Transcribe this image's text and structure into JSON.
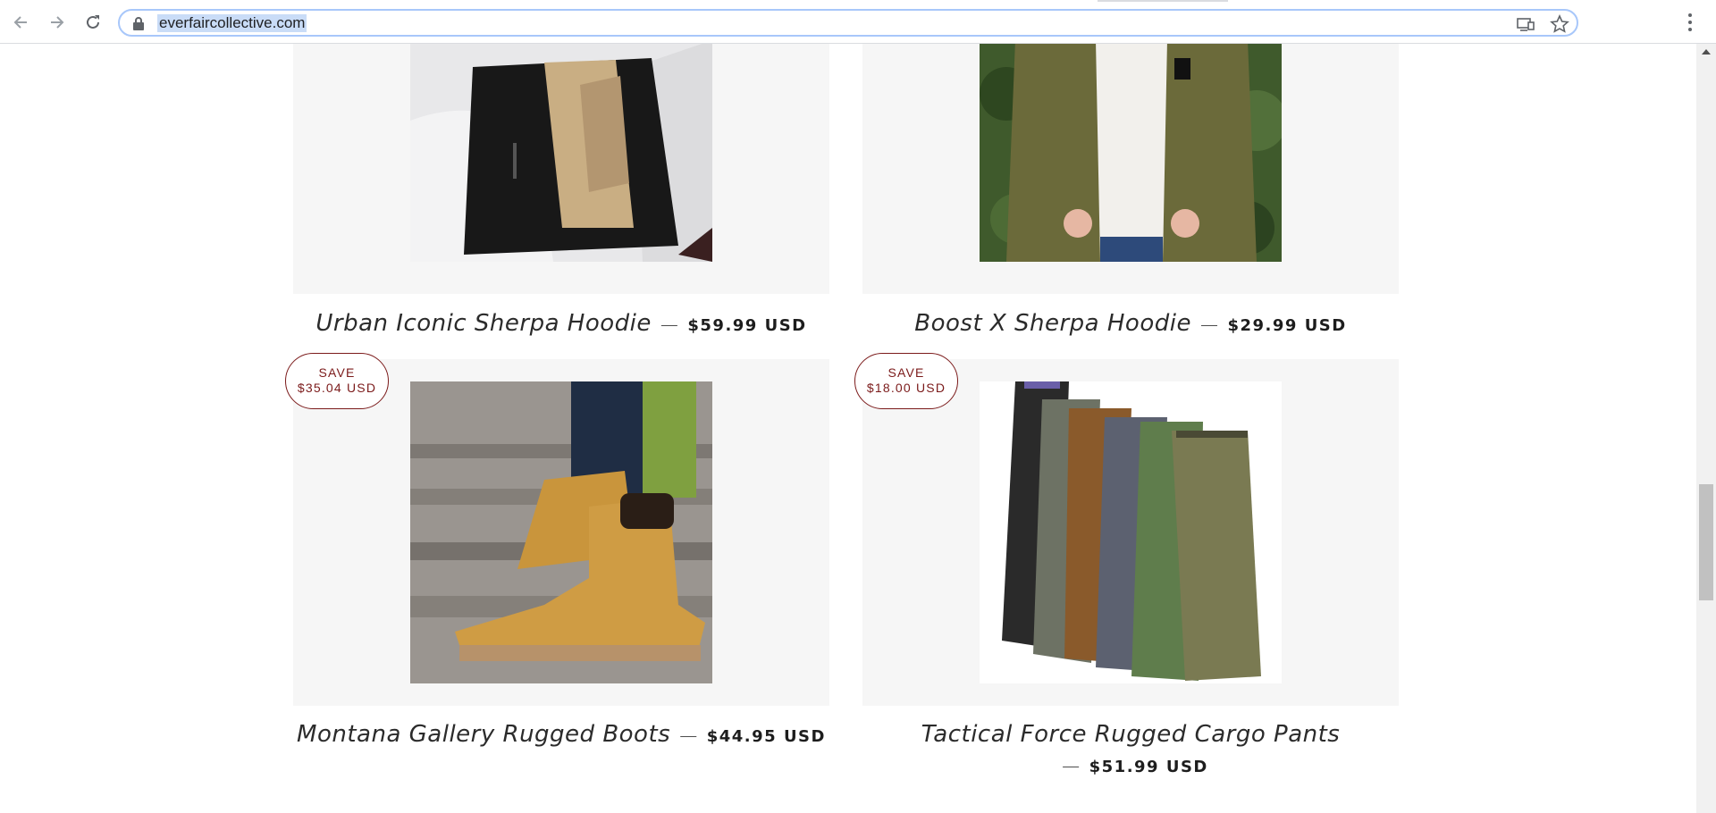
{
  "browser": {
    "url": "everfaircollective.com",
    "icons": {
      "back": "arrow-left-icon",
      "forward": "arrow-right-icon",
      "reload": "reload-icon",
      "lock": "lock-icon",
      "cast": "cast-icon",
      "bookmark": "star-icon",
      "menu": "vertical-dots-icon"
    }
  },
  "products": [
    {
      "name": "Urban Iconic Sherpa Hoodie",
      "separator": "—",
      "price": "$59.99 USD",
      "image": "black sherpa-lined hoodie"
    },
    {
      "name": "Boost X Sherpa Hoodie",
      "separator": "—",
      "price": "$29.99 USD",
      "image": "olive sherpa hoodie worn over white tee"
    },
    {
      "name": "Montana Gallery Rugged Boots",
      "separator": "—",
      "price": "$44.95 USD",
      "badge_line1": "SAVE",
      "badge_line2": "$35.04 USD",
      "image": "tan lace-up work boots"
    },
    {
      "name": "Tactical Force Rugged Cargo Pants",
      "separator": "—",
      "price": "$51.99 USD",
      "badge_line1": "SAVE",
      "badge_line2": "$18.00 USD",
      "image": "stack of cargo pants in several colors"
    }
  ],
  "colors": {
    "card_background": "#f6f6f6",
    "badge": "#7b1a1a",
    "url_highlight": "#c9dcf7"
  }
}
